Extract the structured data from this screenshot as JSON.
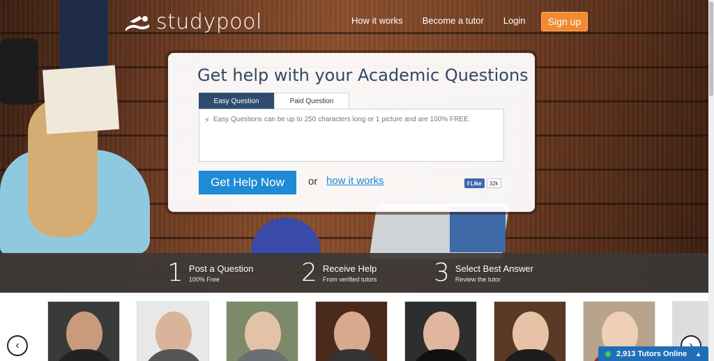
{
  "brand": {
    "name": "studypool"
  },
  "nav": {
    "items": [
      {
        "label": "How it works"
      },
      {
        "label": "Become a tutor"
      },
      {
        "label": "Login"
      }
    ],
    "signup_label": "Sign up"
  },
  "card": {
    "title": "Get help with your Academic Questions",
    "tabs": [
      {
        "label": "Easy Question",
        "active": true
      },
      {
        "label": "Paid Question",
        "active": false
      }
    ],
    "question_placeholder": "Easy Questions can be up to 250 characters long or 1 picture and are 100% FREE.",
    "submit_label": "Get Help Now",
    "or_text": "or",
    "how_link": "how it works",
    "fb_like": "Like",
    "fb_count": "32k"
  },
  "steps": [
    {
      "num": "1",
      "title": "Post a Question",
      "subtitle": "100% Free"
    },
    {
      "num": "2",
      "title": "Receive Help",
      "subtitle": "From verified tutors"
    },
    {
      "num": "3",
      "title": "Select Best Answer",
      "subtitle": "Review the tutor"
    }
  ],
  "online": {
    "label": "2,913 Tutors Online"
  },
  "colors": {
    "accent": "#1f8ad6",
    "signup": "#f28a30",
    "navy": "#2f4c6e",
    "online_badge": "#1f6fb8"
  }
}
